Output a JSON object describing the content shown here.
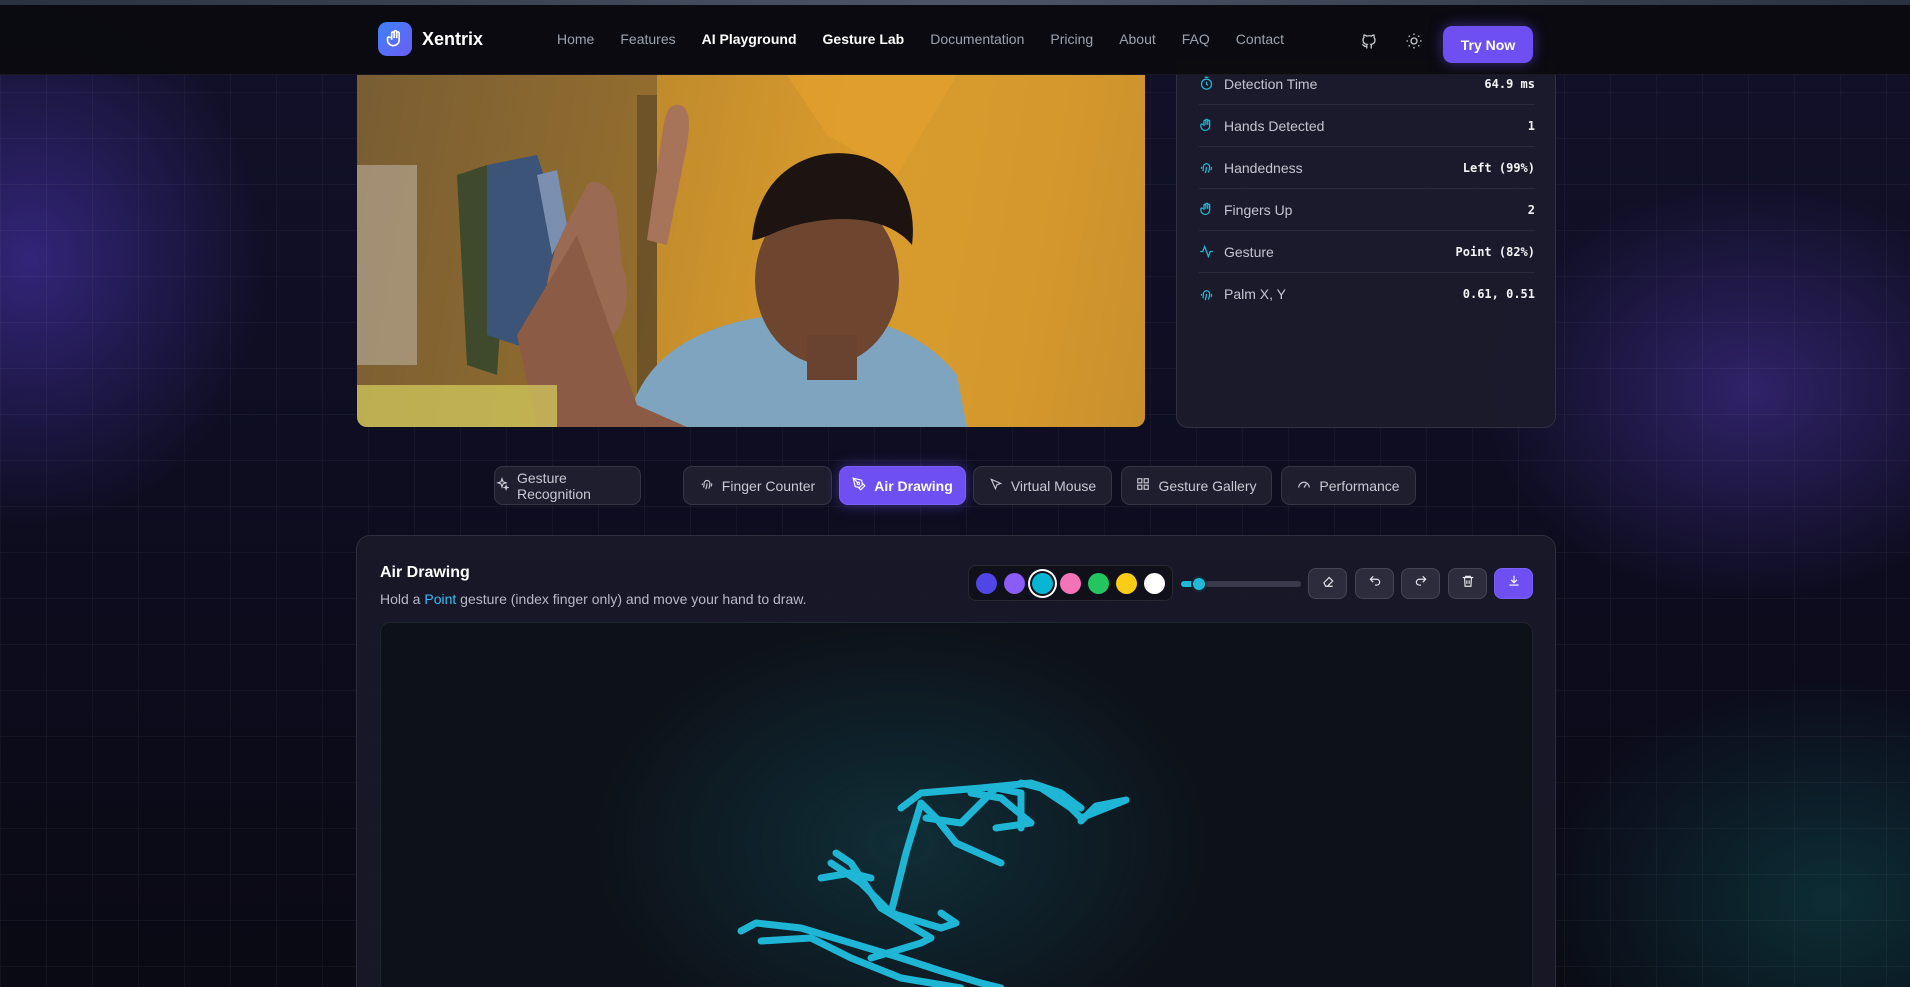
{
  "brand": {
    "name": "Xentrix"
  },
  "nav": {
    "links": [
      {
        "label": "Home",
        "active": false
      },
      {
        "label": "Features",
        "active": false
      },
      {
        "label": "AI Playground",
        "active": true
      },
      {
        "label": "Gesture Lab",
        "active": true
      },
      {
        "label": "Documentation",
        "active": false
      },
      {
        "label": "Pricing",
        "active": false
      },
      {
        "label": "About",
        "active": false
      },
      {
        "label": "FAQ",
        "active": false
      },
      {
        "label": "Contact",
        "active": false
      }
    ],
    "github_icon": "github-icon",
    "theme_icon": "sun-icon",
    "cta_label": "Try Now"
  },
  "stats": {
    "rows": [
      {
        "icon": "timer-icon",
        "label": "Detection Time",
        "value": "64.9 ms"
      },
      {
        "icon": "hand-icon",
        "label": "Hands Detected",
        "value": "1"
      },
      {
        "icon": "fingerprint-icon",
        "label": "Handedness",
        "value": "Left (99%)"
      },
      {
        "icon": "hand-icon",
        "label": "Fingers Up",
        "value": "2"
      },
      {
        "icon": "activity-icon",
        "label": "Gesture",
        "value": "Point (82%)"
      },
      {
        "icon": "fingerprint-icon",
        "label": "Palm X, Y",
        "value": "0.61, 0.51"
      }
    ]
  },
  "tabs": [
    {
      "label": "Gesture Recognition",
      "icon": "sparkles-icon",
      "active": false
    },
    {
      "label": "Finger Counter",
      "icon": "fingerprint-icon",
      "active": false
    },
    {
      "label": "Air Drawing",
      "icon": "pen-tool-icon",
      "active": true
    },
    {
      "label": "Virtual Mouse",
      "icon": "cursor-icon",
      "active": false
    },
    {
      "label": "Gesture Gallery",
      "icon": "grid-icon",
      "active": false
    },
    {
      "label": "Performance",
      "icon": "gauge-icon",
      "active": false
    }
  ],
  "drawing": {
    "title": "Air Drawing",
    "subtitle_before": "Hold a ",
    "subtitle_highlight": "Point",
    "subtitle_after": " gesture (index finger only) and move your hand to draw.",
    "colors": [
      "#4f46e5",
      "#8b5cf6",
      "#06b6d4",
      "#f472b6",
      "#22c55e",
      "#facc15",
      "#ffffff"
    ],
    "selected_color_index": 2,
    "brush_size_fraction": 0.15,
    "stroke_color": "#1fb6d6",
    "tools": [
      {
        "name": "eraser-button",
        "icon": "eraser-icon"
      },
      {
        "name": "undo-button",
        "icon": "undo-icon"
      },
      {
        "name": "redo-button",
        "icon": "redo-icon"
      },
      {
        "name": "clear-button",
        "icon": "trash-icon"
      },
      {
        "name": "download-button",
        "icon": "download-icon"
      }
    ]
  },
  "colors": {
    "accent": "#6d4ff2",
    "highlight": "#38bdf8"
  }
}
